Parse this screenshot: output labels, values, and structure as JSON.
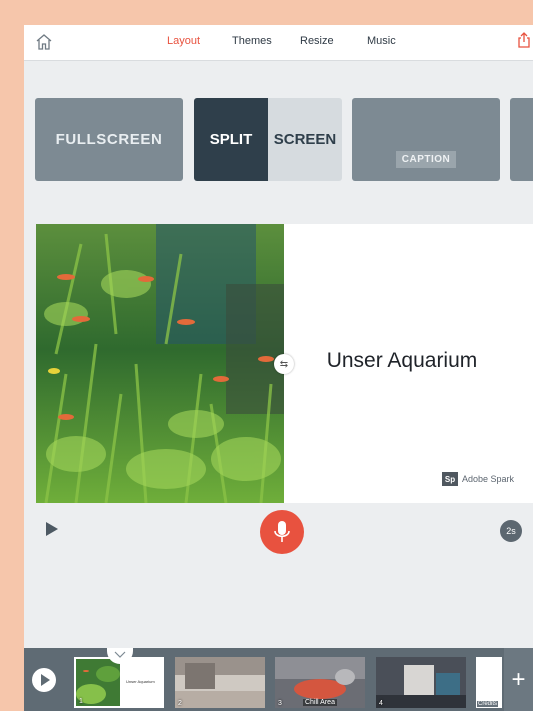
{
  "nav": {
    "tabs": [
      {
        "label": "Layout",
        "active": true
      },
      {
        "label": "Themes",
        "active": false
      },
      {
        "label": "Resize",
        "active": false
      },
      {
        "label": "Music",
        "active": false
      }
    ],
    "icons": {
      "home": "home-icon",
      "share": "share-icon"
    }
  },
  "layouts": {
    "fullscreen": "FULLSCREEN",
    "split_left": "SPLIT",
    "split_right": "SCREEN",
    "caption": "CAPTION"
  },
  "slide": {
    "title": "Unser Aquarium",
    "brand": "Adobe Spark",
    "brand_mark": "Sp"
  },
  "controls": {
    "duration": "2s"
  },
  "filmstrip": {
    "thumbs": [
      {
        "num": "1",
        "caption": "",
        "title": "Unser Aquarium"
      },
      {
        "num": "2",
        "caption": ""
      },
      {
        "num": "3",
        "caption": "Chill Area"
      },
      {
        "num": "4",
        "caption": ""
      }
    ],
    "credits": "Credits",
    "add": "+"
  },
  "colors": {
    "accent": "#e8523f",
    "slate": "#7d8a93",
    "dark_slate": "#2f3f4b",
    "frame": "#f6c6ab"
  }
}
